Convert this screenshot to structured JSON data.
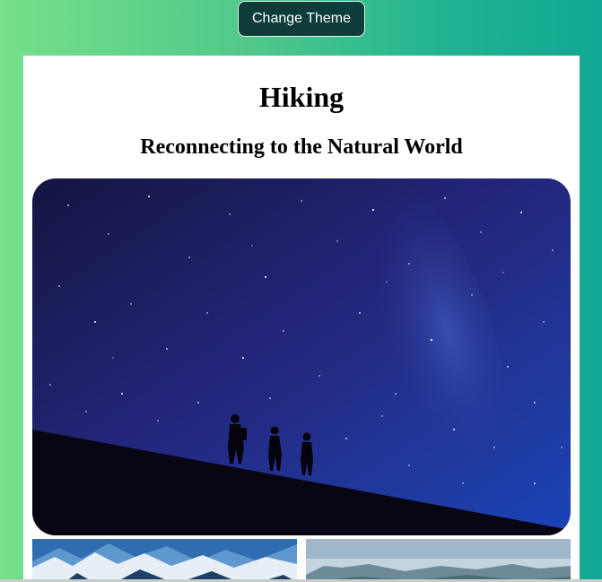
{
  "controls": {
    "change_theme_label": "Change Theme"
  },
  "article": {
    "title": "Hiking",
    "subtitle": "Reconnecting to the Natural World"
  },
  "images": {
    "hero": "night-sky-hikers-image",
    "thumb_1": "snowy-mountains-image",
    "thumb_2": "mountain-valley-image"
  },
  "colors": {
    "button_bg": "#0e3c3a",
    "gradient_start": "#76e08a",
    "gradient_end": "#10a893"
  }
}
